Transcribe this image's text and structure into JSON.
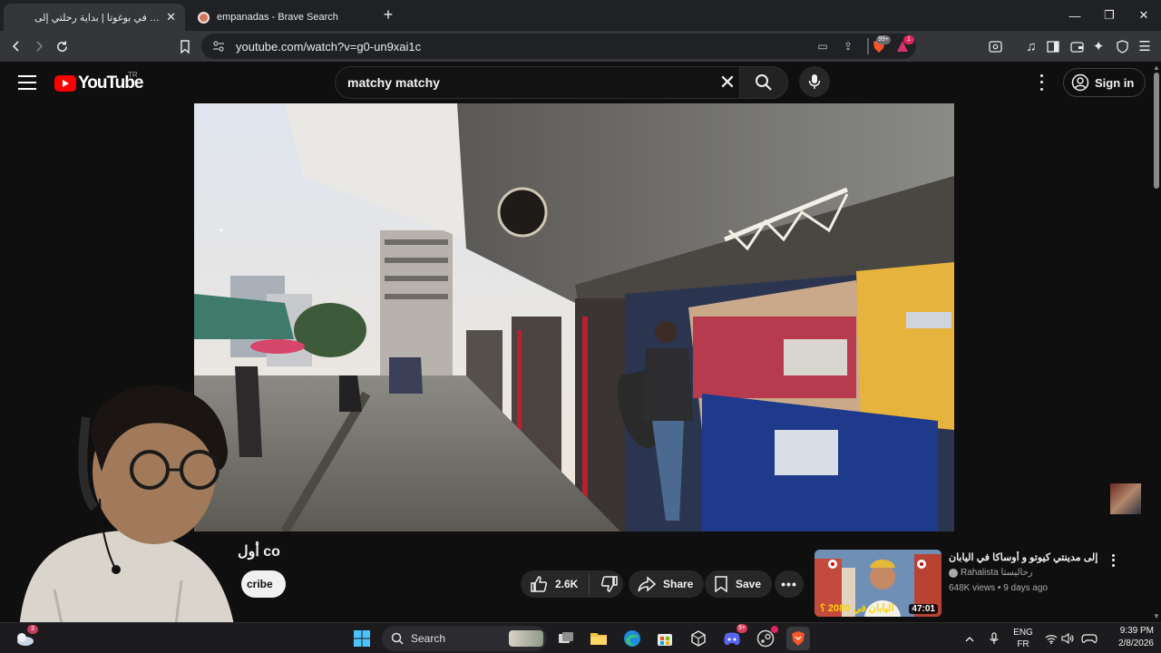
{
  "browser": {
    "tabs": [
      {
        "title": "أول يوم في بوغوتا | بداية رحلتي إلى",
        "active": true,
        "favicon": "youtube-icon"
      },
      {
        "title": "empanadas - Brave Search",
        "active": false,
        "favicon": "brave-icon"
      }
    ],
    "url": "youtube.com/watch?v=g0-un9xai1c",
    "shields_count": "99+",
    "rewards_count": "1"
  },
  "youtube": {
    "logo_text": "YouTube",
    "country_code": "TR",
    "search_query": "matchy matchy",
    "sign_in_label": "Sign in",
    "video": {
      "title": "أول co",
      "subscribe_label": "cribe",
      "like_count": "2.6K",
      "share_label": "Share",
      "save_label": "Save"
    },
    "recommendation": {
      "title": "سافرت إلى مدينتي كيوتو و أوساكا في اليابان",
      "channel": "Rahalista رحاليستا",
      "views": "648K views",
      "age": "9 days ago",
      "meta": "648K views • 9 days ago",
      "duration": "47:01",
      "thumb_text": "اليابان في 2080 ؟"
    }
  },
  "taskbar": {
    "search_placeholder": "Search",
    "weather_badge": "3",
    "discord_badge": "9+",
    "language": "ENG",
    "layout": "FR",
    "time": "9:39 PM",
    "date": "2/8/2026"
  },
  "colors": {
    "youtube_red": "#ff0000",
    "background": "#0f0f0f",
    "brave_orange": "#fb542b"
  }
}
